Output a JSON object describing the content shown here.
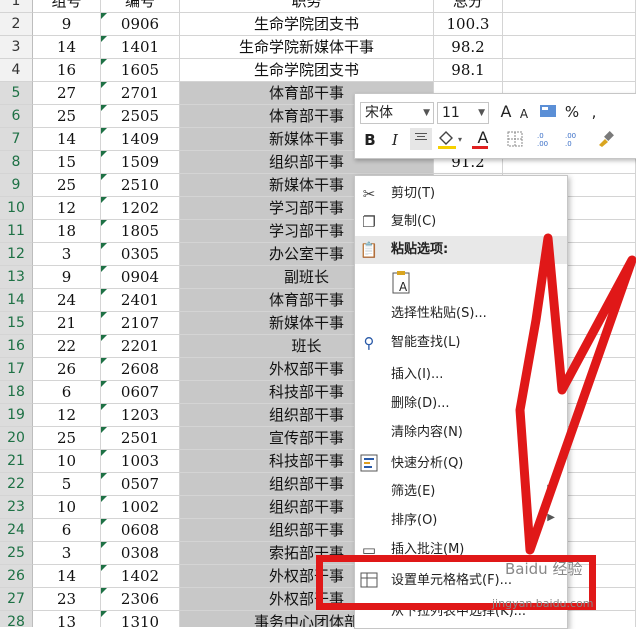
{
  "sheet": {
    "header_row": {
      "rownum": "1",
      "c1": "组号",
      "c2": "编号",
      "c3": "职务",
      "c4": "总分"
    },
    "rows": [
      {
        "rownum": "2",
        "c1": "9",
        "c2": "0906",
        "c3": "生命学院团支书",
        "c4": "100.3"
      },
      {
        "rownum": "3",
        "c1": "14",
        "c2": "1401",
        "c3": "生命学院新媒体干事",
        "c4": "98.2"
      },
      {
        "rownum": "4",
        "c1": "16",
        "c2": "1605",
        "c3": "生命学院团支书",
        "c4": "98.1"
      },
      {
        "rownum": "5",
        "c1": "27",
        "c2": "2701",
        "c3": "体育部干事",
        "c4": ""
      },
      {
        "rownum": "6",
        "c1": "25",
        "c2": "2505",
        "c3": "体育部干事",
        "c4": ""
      },
      {
        "rownum": "7",
        "c1": "14",
        "c2": "1409",
        "c3": "新媒体干事",
        "c4": ""
      },
      {
        "rownum": "8",
        "c1": "15",
        "c2": "1509",
        "c3": "组织部干事",
        "c4": "91.2"
      },
      {
        "rownum": "9",
        "c1": "25",
        "c2": "2510",
        "c3": "新媒体干事",
        "c4": ""
      },
      {
        "rownum": "10",
        "c1": "12",
        "c2": "1202",
        "c3": "学习部干事",
        "c4": ""
      },
      {
        "rownum": "11",
        "c1": "18",
        "c2": "1805",
        "c3": "学习部干事",
        "c4": ""
      },
      {
        "rownum": "12",
        "c1": "3",
        "c2": "0305",
        "c3": "办公室干事",
        "c4": ""
      },
      {
        "rownum": "13",
        "c1": "9",
        "c2": "0904",
        "c3": "副班长",
        "c4": ""
      },
      {
        "rownum": "14",
        "c1": "24",
        "c2": "2401",
        "c3": "体育部干事",
        "c4": ""
      },
      {
        "rownum": "15",
        "c1": "21",
        "c2": "2107",
        "c3": "新媒体干事",
        "c4": ""
      },
      {
        "rownum": "16",
        "c1": "22",
        "c2": "2201",
        "c3": "班长",
        "c4": ""
      },
      {
        "rownum": "17",
        "c1": "26",
        "c2": "2608",
        "c3": "外权部干事",
        "c4": ""
      },
      {
        "rownum": "18",
        "c1": "6",
        "c2": "0607",
        "c3": "科技部干事",
        "c4": ""
      },
      {
        "rownum": "19",
        "c1": "12",
        "c2": "1203",
        "c3": "组织部干事",
        "c4": ""
      },
      {
        "rownum": "20",
        "c1": "25",
        "c2": "2501",
        "c3": "宣传部干事",
        "c4": ""
      },
      {
        "rownum": "21",
        "c1": "10",
        "c2": "1003",
        "c3": "科技部干事",
        "c4": ""
      },
      {
        "rownum": "22",
        "c1": "5",
        "c2": "0507",
        "c3": "组织部干事",
        "c4": ""
      },
      {
        "rownum": "23",
        "c1": "10",
        "c2": "1002",
        "c3": "组织部干事",
        "c4": ""
      },
      {
        "rownum": "24",
        "c1": "6",
        "c2": "0608",
        "c3": "组织部干事",
        "c4": ""
      },
      {
        "rownum": "25",
        "c1": "3",
        "c2": "0308",
        "c3": "索拓部干事",
        "c4": ""
      },
      {
        "rownum": "26",
        "c1": "14",
        "c2": "1402",
        "c3": "外权部干事",
        "c4": ""
      },
      {
        "rownum": "27",
        "c1": "23",
        "c2": "2306",
        "c3": "外权部干事",
        "c4": ""
      },
      {
        "rownum": "28",
        "c1": "13",
        "c2": "1310",
        "c3": "事务中心团体部",
        "c4": ""
      }
    ]
  },
  "mini_toolbar": {
    "font_name": "宋体",
    "font_size": "11",
    "grow_font": "A",
    "shrink_font": "A",
    "percent": "%",
    "comma": ",",
    "bold": "B",
    "italic": "I",
    "font_color_letter": "A",
    "font_color": "#e02020",
    "fill_color": "#f6d000"
  },
  "context_menu": {
    "cut": "剪切(T)",
    "copy": "复制(C)",
    "paste_options": "粘贴选项:",
    "paste_special": "选择性粘贴(S)...",
    "smart_lookup": "智能查找(L)",
    "insert": "插入(I)...",
    "delete": "删除(D)...",
    "clear_contents": "清除内容(N)",
    "quick_analysis": "快速分析(Q)",
    "filter": "筛选(E)",
    "sort": "排序(O)",
    "insert_comment": "插入批注(M)",
    "format_cells": "设置单元格格式(F)...",
    "pick_from_list": "从下拉列表中选择(K)..."
  },
  "watermark": {
    "text": "Baidu 经验",
    "url": "jingyan.baidu.com"
  },
  "colors": {
    "highlight": "#e01818",
    "selected_header": "#1e7145",
    "selection_fill": "#c8c8c8"
  }
}
